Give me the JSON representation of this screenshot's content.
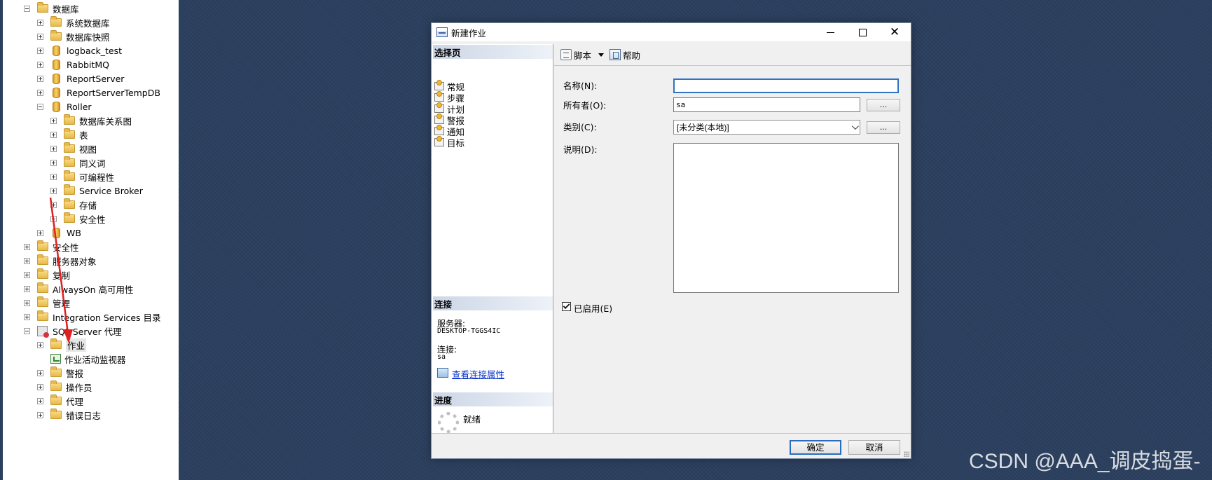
{
  "explorer": {
    "tree": [
      {
        "label": "数据库",
        "level": 0,
        "expander": "minus",
        "icon": "folder-icon"
      },
      {
        "label": "系统数据库",
        "level": 1,
        "expander": "plus",
        "icon": "folder-icon"
      },
      {
        "label": "数据库快照",
        "level": 1,
        "expander": "plus",
        "icon": "folder-icon"
      },
      {
        "label": "logback_test",
        "level": 1,
        "expander": "plus",
        "icon": "database-icon"
      },
      {
        "label": "RabbitMQ",
        "level": 1,
        "expander": "plus",
        "icon": "database-icon"
      },
      {
        "label": "ReportServer",
        "level": 1,
        "expander": "plus",
        "icon": "database-icon"
      },
      {
        "label": "ReportServerTempDB",
        "level": 1,
        "expander": "plus",
        "icon": "database-icon"
      },
      {
        "label": "Roller",
        "level": 1,
        "expander": "minus",
        "icon": "database-icon"
      },
      {
        "label": "数据库关系图",
        "level": 2,
        "expander": "plus",
        "icon": "folder-icon"
      },
      {
        "label": "表",
        "level": 2,
        "expander": "plus",
        "icon": "folder-icon"
      },
      {
        "label": "视图",
        "level": 2,
        "expander": "plus",
        "icon": "folder-icon"
      },
      {
        "label": "同义词",
        "level": 2,
        "expander": "plus",
        "icon": "folder-icon"
      },
      {
        "label": "可编程性",
        "level": 2,
        "expander": "plus",
        "icon": "folder-icon"
      },
      {
        "label": "Service Broker",
        "level": 2,
        "expander": "plus",
        "icon": "folder-icon"
      },
      {
        "label": "存储",
        "level": 2,
        "expander": "plus",
        "icon": "folder-icon"
      },
      {
        "label": "安全性",
        "level": 2,
        "expander": "plus",
        "icon": "folder-icon"
      },
      {
        "label": "WB",
        "level": 1,
        "expander": "plus",
        "icon": "database-icon"
      },
      {
        "label": "安全性",
        "level": 0,
        "expander": "plus",
        "icon": "folder-icon"
      },
      {
        "label": "服务器对象",
        "level": 0,
        "expander": "plus",
        "icon": "folder-icon"
      },
      {
        "label": "复制",
        "level": 0,
        "expander": "plus",
        "icon": "folder-icon"
      },
      {
        "label": "AlwaysOn 高可用性",
        "level": 0,
        "expander": "plus",
        "icon": "folder-icon"
      },
      {
        "label": "管理",
        "level": 0,
        "expander": "plus",
        "icon": "folder-icon"
      },
      {
        "label": "Integration Services 目录",
        "level": 0,
        "expander": "plus",
        "icon": "folder-icon"
      },
      {
        "label": "SQL Server 代理",
        "level": 0,
        "expander": "minus",
        "icon": "sql-agent-icon"
      },
      {
        "label": "作业",
        "level": 1,
        "expander": "plus",
        "icon": "folder-icon",
        "selected": true
      },
      {
        "label": "作业活动监视器",
        "level": 1,
        "expander": "none",
        "icon": "activity-monitor-icon"
      },
      {
        "label": "警报",
        "level": 1,
        "expander": "plus",
        "icon": "folder-icon"
      },
      {
        "label": "操作员",
        "level": 1,
        "expander": "plus",
        "icon": "folder-icon"
      },
      {
        "label": "代理",
        "level": 1,
        "expander": "plus",
        "icon": "folder-icon"
      },
      {
        "label": "错误日志",
        "level": 1,
        "expander": "plus",
        "icon": "folder-icon"
      }
    ]
  },
  "dialog": {
    "title": "新建作业",
    "select_page_header": "选择页",
    "pages": [
      "常规",
      "步骤",
      "计划",
      "警报",
      "通知",
      "目标"
    ],
    "connection": {
      "header": "连接",
      "server_label": "服务器:",
      "server_value": "DESKTOP-TGGS4IC",
      "connection_label": "连接:",
      "connection_value": "sa",
      "view_link": "查看连接属性"
    },
    "progress": {
      "header": "进度",
      "status": "就绪"
    },
    "toolbar": {
      "script_label": "脚本",
      "help_label": "帮助"
    },
    "form": {
      "name_label": "名称(N):",
      "name_value": "",
      "owner_label": "所有者(O):",
      "owner_value": "sa",
      "category_label": "类别(C):",
      "category_value": "[未分类(本地)]",
      "description_label": "说明(D):",
      "description_value": "",
      "ellipsis": "...",
      "enabled_label": "已启用(E)",
      "enabled": true
    },
    "buttons": {
      "ok": "确定",
      "cancel": "取消"
    }
  },
  "watermark": "CSDN @AAA_调皮捣蛋-",
  "colors": {
    "desktop": "#2b3f5e",
    "annotation_arrow": "#e02020",
    "link": "#0b33c7",
    "focus_border": "#2f73c4"
  }
}
